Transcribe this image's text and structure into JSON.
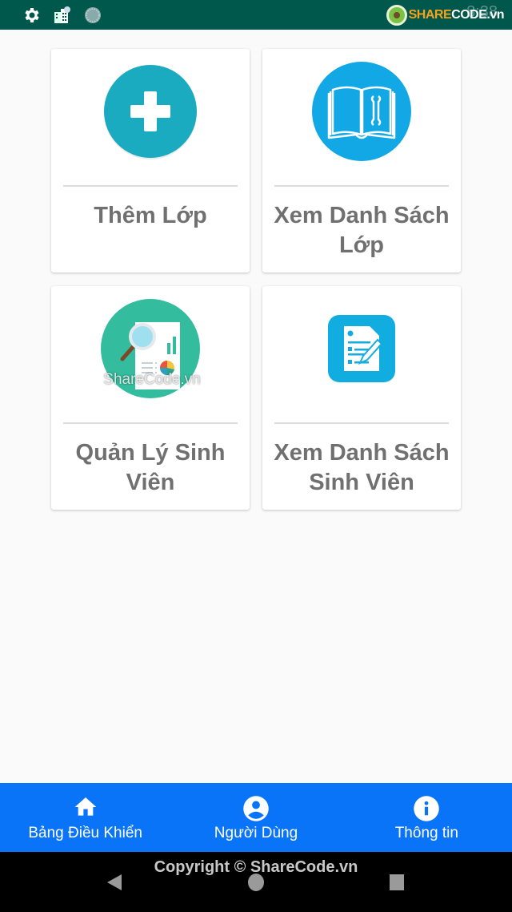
{
  "status_bar": {
    "icons": [
      "gear-icon",
      "building-notification-icon",
      "sync-circle-icon"
    ],
    "time": "8:38",
    "watermark": {
      "part1": "SHARE",
      "part2": "CODE",
      "part3": ".vn"
    }
  },
  "dashboard": {
    "cards": [
      {
        "label": "Thêm Lớp",
        "icon": "add-circle-icon",
        "color": "#1aabc1"
      },
      {
        "label": "Xem Danh Sách Lớp",
        "icon": "manual-book-icon",
        "color": "#12a7e5"
      },
      {
        "label": "Quản Lý Sinh Viên",
        "icon": "report-analysis-icon",
        "color": "#34bc9e"
      },
      {
        "label": "Xem Danh Sách Sinh Viên",
        "icon": "edit-document-icon",
        "color": "#12ade0"
      }
    ],
    "watermark": "ShareCode.vn"
  },
  "bottom_nav": {
    "items": [
      {
        "label": "Bảng Điều Khiển",
        "icon": "home-icon"
      },
      {
        "label": "Người Dùng",
        "icon": "account-circle-icon"
      },
      {
        "label": "Thông tin",
        "icon": "info-icon"
      }
    ],
    "background": "#0a74f8"
  },
  "system_nav": {
    "copyright": "Copyright © ShareCode.vn",
    "buttons": [
      "back",
      "home",
      "recents"
    ]
  }
}
